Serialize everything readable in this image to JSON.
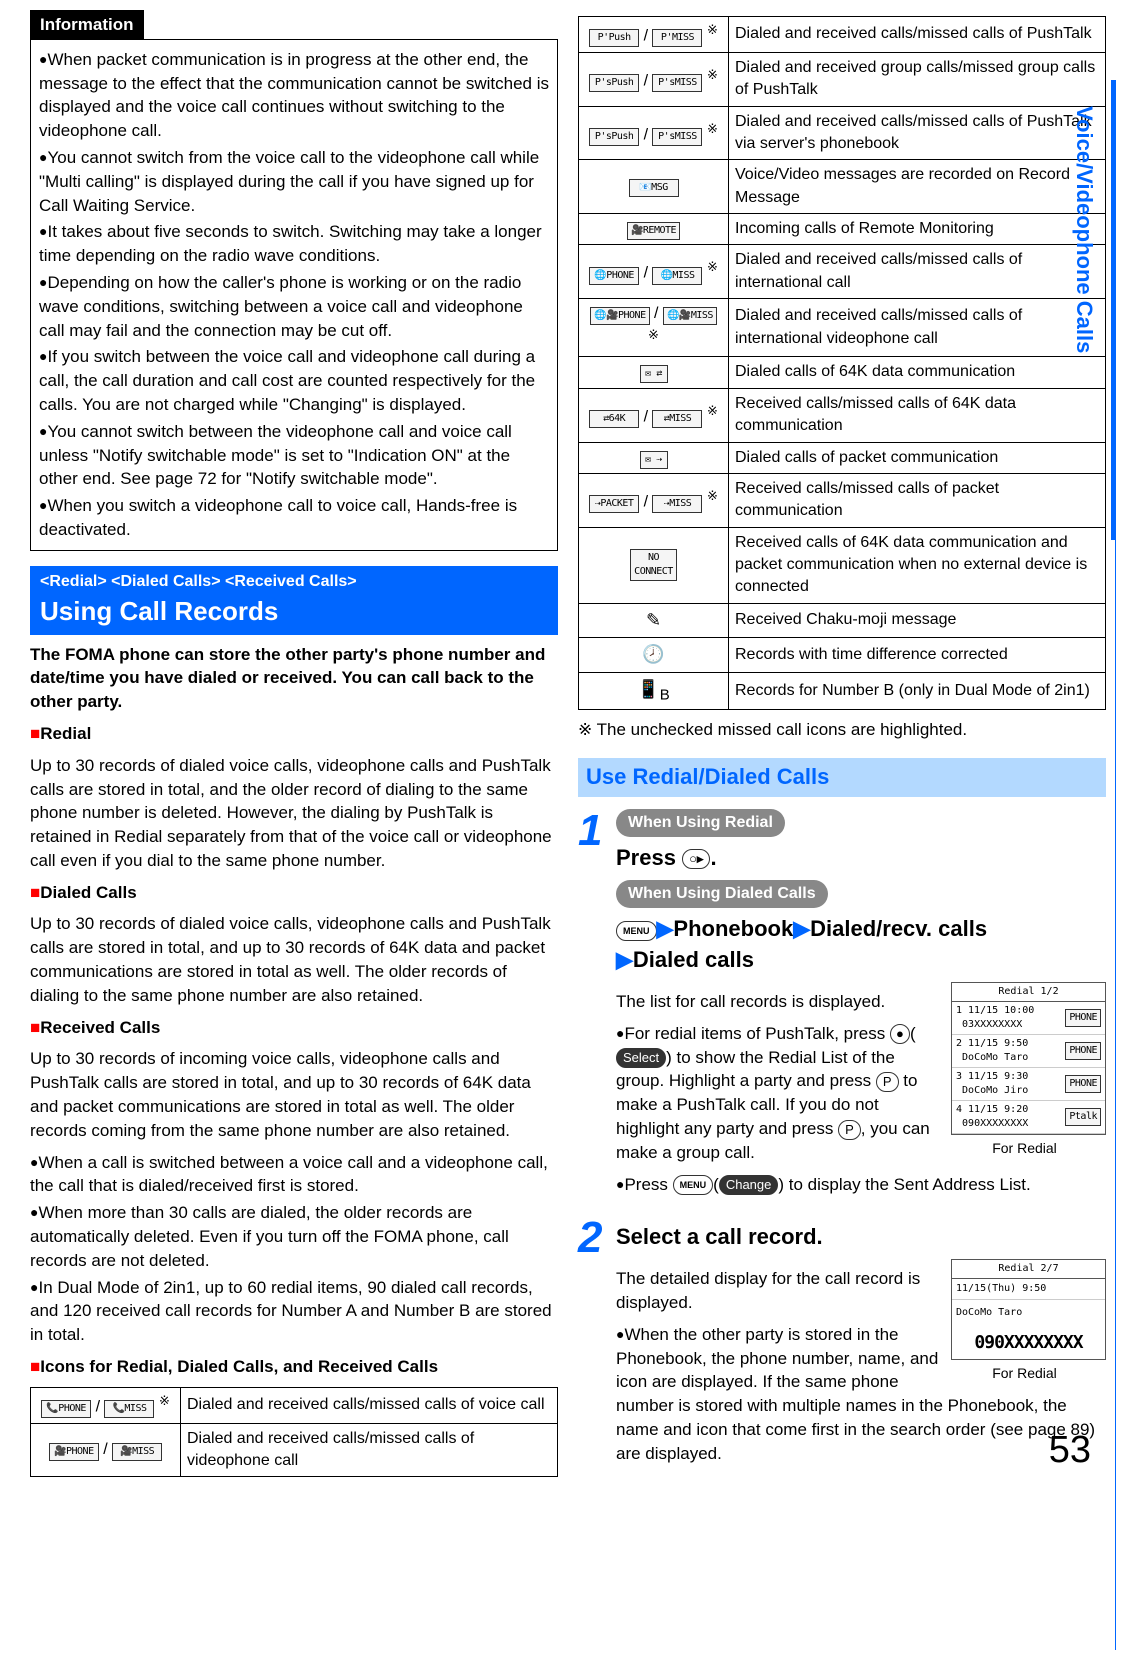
{
  "left": {
    "info_title": "Information",
    "info_items": [
      "When packet communication is in progress at the other end, the message to the effect that the communication cannot be switched is displayed and the voice call continues without switching to the videophone call.",
      "You cannot switch from the voice call to the videophone call while \"Multi calling\" is displayed during the call if you have signed up for Call Waiting Service.",
      "It takes about five seconds to switch. Switching may take a longer time depending on the radio wave conditions.",
      "Depending on how the caller's phone is working or on the radio wave conditions, switching between a voice call and videophone call may fail and the connection may be cut off.",
      "If you switch between the voice call and videophone call during a call, the call duration and call cost are counted respectively for the calls. You are not charged while \"Changing\" is displayed.",
      "You cannot switch between the videophone call and voice call unless \"Notify switchable mode\" is set to \"Indication ON\" at the other end. See page 72 for \"Notify switchable mode\".",
      "When you switch a videophone call to voice call, Hands-free is deactivated."
    ],
    "blue_sub": "<Redial> <Dialed Calls> <Received Calls>",
    "blue_main": "Using Call Records",
    "intro": "The FOMA phone can store the other party's phone number and date/time you have dialed or received. You can call back to the other party.",
    "redial_h": "Redial",
    "redial_t": "Up to 30 records of dialed voice calls, videophone calls and PushTalk calls are stored in total, and the older record of dialing to the same phone number is deleted. However, the dialing by PushTalk is retained in Redial separately from that of the voice call or videophone call even if you dial to the same phone number.",
    "dialed_h": "Dialed Calls",
    "dialed_t": "Up to 30 records of dialed voice calls, videophone calls and PushTalk calls are stored in total, and up to 30 records of 64K data and packet communications are stored in total as well. The older records of dialing to the same phone number are also retained.",
    "recv_h": "Received Calls",
    "recv_t": "Up to 30 records of incoming voice calls, videophone calls and PushTalk calls are stored in total, and up to 30 records of 64K data and packet communications are stored in total as well. The older records coming from the same phone number are also retained.",
    "recv_bullets": [
      "When a call is switched between a voice call and a videophone call, the call that is dialed/received first is stored.",
      "When more than 30 calls are dialed, the older records are automatically deleted. Even if you turn off the FOMA phone, call records are not deleted.",
      "In Dual Mode of 2in1, up to 60 redial items, 90 dialed call records, and 120 received call records for Number A and Number B are stored in total."
    ],
    "icons_h": "Icons for Redial, Dialed Calls, and Received Calls",
    "icons_left": [
      {
        "desc": "Dialed and received calls/missed calls of voice call",
        "star": true
      },
      {
        "desc": "Dialed and received calls/missed calls of videophone call"
      }
    ]
  },
  "right": {
    "icons": [
      {
        "desc": "Dialed and received calls/missed calls of PushTalk",
        "star": true
      },
      {
        "desc": "Dialed and received group calls/missed group calls of PushTalk",
        "star": true
      },
      {
        "desc": "Dialed and received calls/missed calls of PushTalk via server's phonebook",
        "star": true
      },
      {
        "desc": "Voice/Video messages are recorded on Record Message"
      },
      {
        "desc": "Incoming calls of Remote Monitoring"
      },
      {
        "desc": "Dialed and received calls/missed calls of international call",
        "star": true
      },
      {
        "desc": "Dialed and received calls/missed calls of international videophone call",
        "star": true
      },
      {
        "desc": "Dialed calls of 64K data communication"
      },
      {
        "desc": "Received calls/missed calls of 64K data communication",
        "star": true
      },
      {
        "desc": "Dialed calls of packet communication"
      },
      {
        "desc": "Received calls/missed calls of packet communication",
        "star": true
      },
      {
        "desc": "Received calls of 64K data communication and packet communication when no external device is connected"
      },
      {
        "desc": "Received Chaku-moji message"
      },
      {
        "desc": "Records with time difference corrected"
      },
      {
        "desc": "Records for Number B (only in Dual Mode of 2in1)"
      }
    ],
    "note": "※ The unchecked missed call icons are highlighted.",
    "light_blue": "Use Redial/Dialed Calls",
    "step1": {
      "pill1": "When Using Redial",
      "press": "Press ",
      "dot": ".",
      "pill2": "When Using Dialed Calls",
      "nav_pb": "Phonebook",
      "nav_dr": "Dialed/recv. calls",
      "nav_dc": "Dialed calls",
      "list_t": "The list for call records is displayed.",
      "b1a": "For redial items of PushTalk, press ",
      "b1_select": "Select",
      "b1b": " to show the Redial List of the group. Highlight a party and press ",
      "b1c": " to make a PushTalk call. If you do not highlight any party and press ",
      "b1d": ", you can make a group call.",
      "b2a": "Press ",
      "b2_change": "Change",
      "b2b": " to display the Sent Address List.",
      "screen_hdr": "Redial       1/2",
      "screen_rows": [
        {
          "l": "1 11/15 10:00",
          "n": "03XXXXXXXX",
          "tag": "PHONE"
        },
        {
          "l": "2 11/15  9:50",
          "n": "DoCoMo Taro",
          "tag": "PHONE"
        },
        {
          "l": "3 11/15  9:30",
          "n": "DoCoMo Jiro",
          "tag": "PHONE"
        },
        {
          "l": "4 11/15  9:20",
          "n": "090XXXXXXXX",
          "tag": "Ptalk"
        }
      ],
      "cap": "For Redial"
    },
    "step2": {
      "title": "Select a call record.",
      "t": "The detailed display for the call record is displayed.",
      "b": "When the other party is stored in the Phonebook, the phone number, name, and icon are displayed. If the same phone number is stored with multiple names in the Phonebook, the name and icon that come first in the search order (see page 89) are displayed.",
      "screen_hdr": "Redial       2/7",
      "screen_date": "11/15(Thu) 9:50",
      "screen_name": "DoCoMo Taro",
      "screen_num": "090XXXXXXXX",
      "cap": "For Redial"
    }
  },
  "side_tab": "Voice/Videophone Calls",
  "pagenum": "53"
}
